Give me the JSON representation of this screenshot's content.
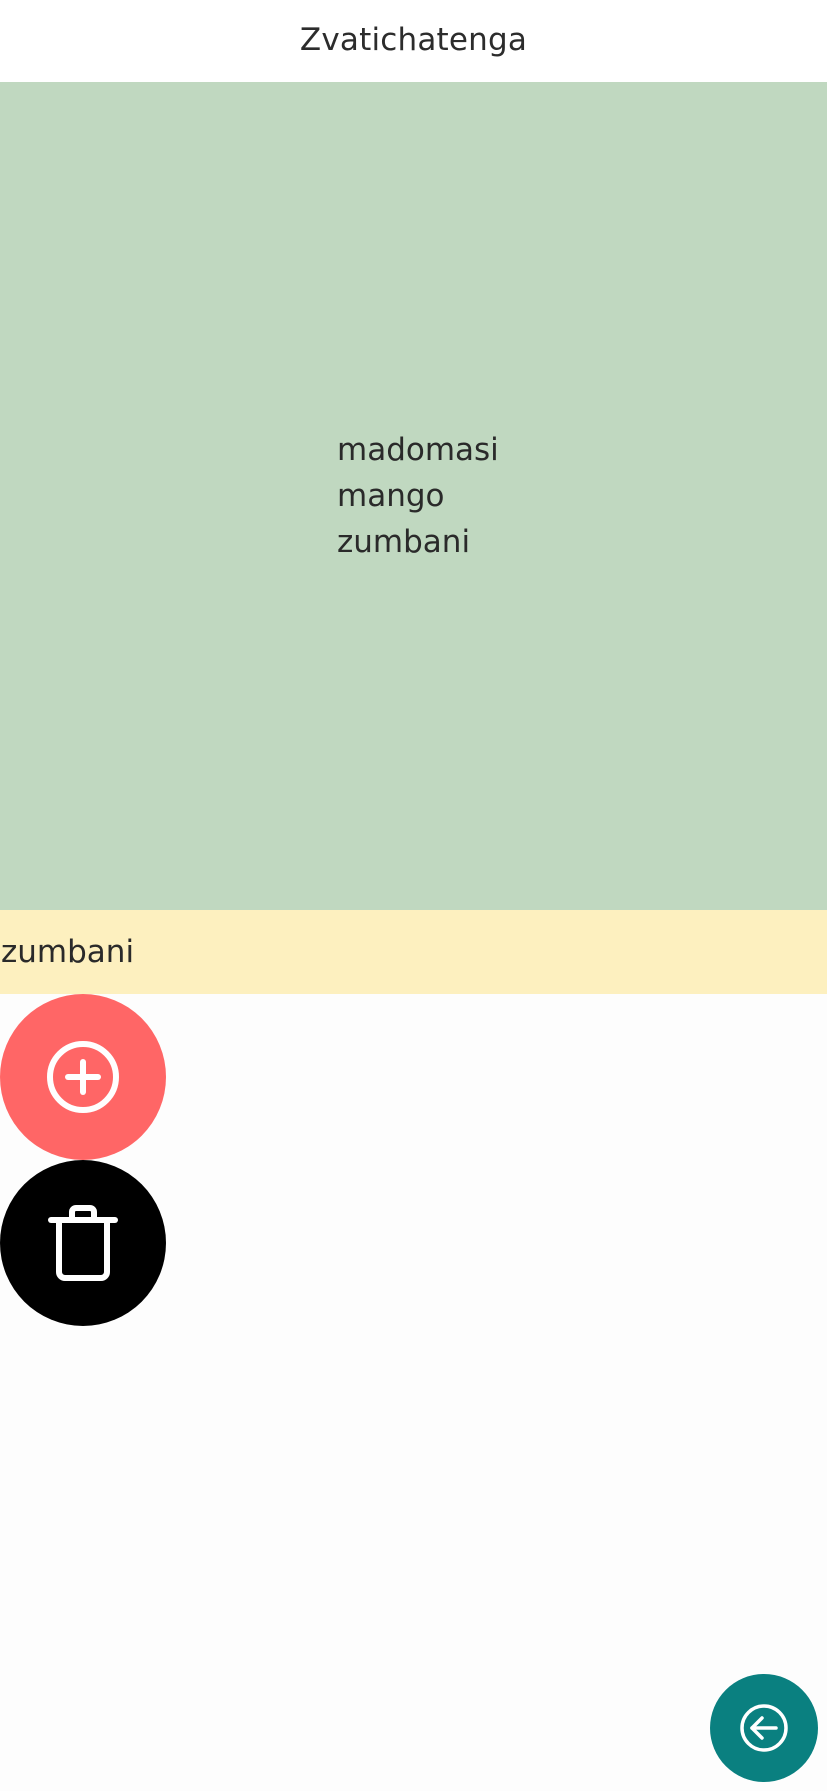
{
  "app_bar": {
    "title": "Zvatichatenga"
  },
  "list": {
    "items": [
      "madomasi",
      "mango",
      "zumbani"
    ]
  },
  "selection": {
    "value": "zumbani"
  },
  "actions": {
    "add_icon": "plus-circle-icon",
    "delete_icon": "trash-icon",
    "back_icon": "arrow-left-circle-icon"
  },
  "colors": {
    "list_background": "#c0d8c0",
    "selection_background": "#fdf0bf",
    "add_button": "#ff6666",
    "delete_button": "#000000",
    "back_button": "#0a8080"
  }
}
